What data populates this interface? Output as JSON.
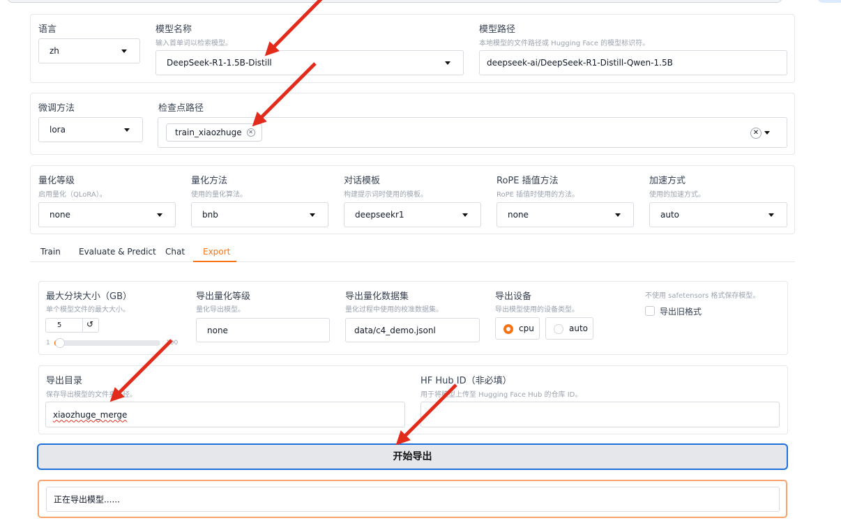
{
  "colors": {
    "accent": "#f97316",
    "focus_border": "#1d6fdc",
    "arrow": "#e32b1c"
  },
  "model_panel": {
    "language_label": "语言",
    "language_value": "zh",
    "model_name_label": "模型名称",
    "model_name_hint": "输入首单词以检索模型。",
    "model_name_value": "DeepSeek-R1-1.5B-Distill",
    "model_path_label": "模型路径",
    "model_path_hint": "本地模型的文件路径或 Hugging Face 的模型标识符。",
    "model_path_value": "deepseek-ai/DeepSeek-R1-Distill-Qwen-1.5B"
  },
  "finetune_panel": {
    "method_label": "微调方法",
    "method_value": "lora",
    "checkpoint_label": "检查点路径",
    "checkpoint_tag": "train_xiaozhuge"
  },
  "quant_panel": {
    "quant_level_label": "量化等级",
    "quant_level_hint": "启用量化（QLoRA）。",
    "quant_level_value": "none",
    "quant_method_label": "量化方法",
    "quant_method_hint": "使用的量化算法。",
    "quant_method_value": "bnb",
    "template_label": "对话模板",
    "template_hint": "构建提示词时使用的模板。",
    "template_value": "deepseekr1",
    "rope_label": "RoPE 插值方法",
    "rope_hint": "RoPE 插值时使用的方法。",
    "rope_value": "none",
    "booster_label": "加速方式",
    "booster_hint": "使用的加速方式。",
    "booster_value": "auto"
  },
  "tabs": [
    "Train",
    "Evaluate & Predict",
    "Chat",
    "Export"
  ],
  "active_tab": "Export",
  "export": {
    "shard_label": "最大分块大小（GB）",
    "shard_hint": "单个模型文件的最大大小。",
    "shard_value": "5",
    "slider_min": "1",
    "slider_max": "100",
    "slider_fraction": 0.03,
    "quant_bit_label": "导出量化等级",
    "quant_bit_hint": "量化导出模型。",
    "quant_bit_value": "none",
    "quant_dataset_label": "导出量化数据集",
    "quant_dataset_hint": "量化过程中使用的校准数据集。",
    "quant_dataset_value": "data/c4_demo.jsonl",
    "device_label": "导出设备",
    "device_hint": "导出模型使用的设备类型。",
    "device_options": [
      "cpu",
      "auto"
    ],
    "device_selected": "cpu",
    "legacy_hint": "不使用 safetensors 格式保存模型。",
    "legacy_label": "导出旧格式",
    "legacy_checked": false,
    "dir_label": "导出目录",
    "dir_hint": "保存导出模型的文件夹路径。",
    "dir_value": "xiaozhuge_merge",
    "hub_label": "HF Hub ID（非必填）",
    "hub_hint": "用于将模型上传至 Hugging Face Hub 的仓库 ID。",
    "hub_value": "",
    "start_button": "开始导出",
    "status": "正在导出模型......"
  }
}
